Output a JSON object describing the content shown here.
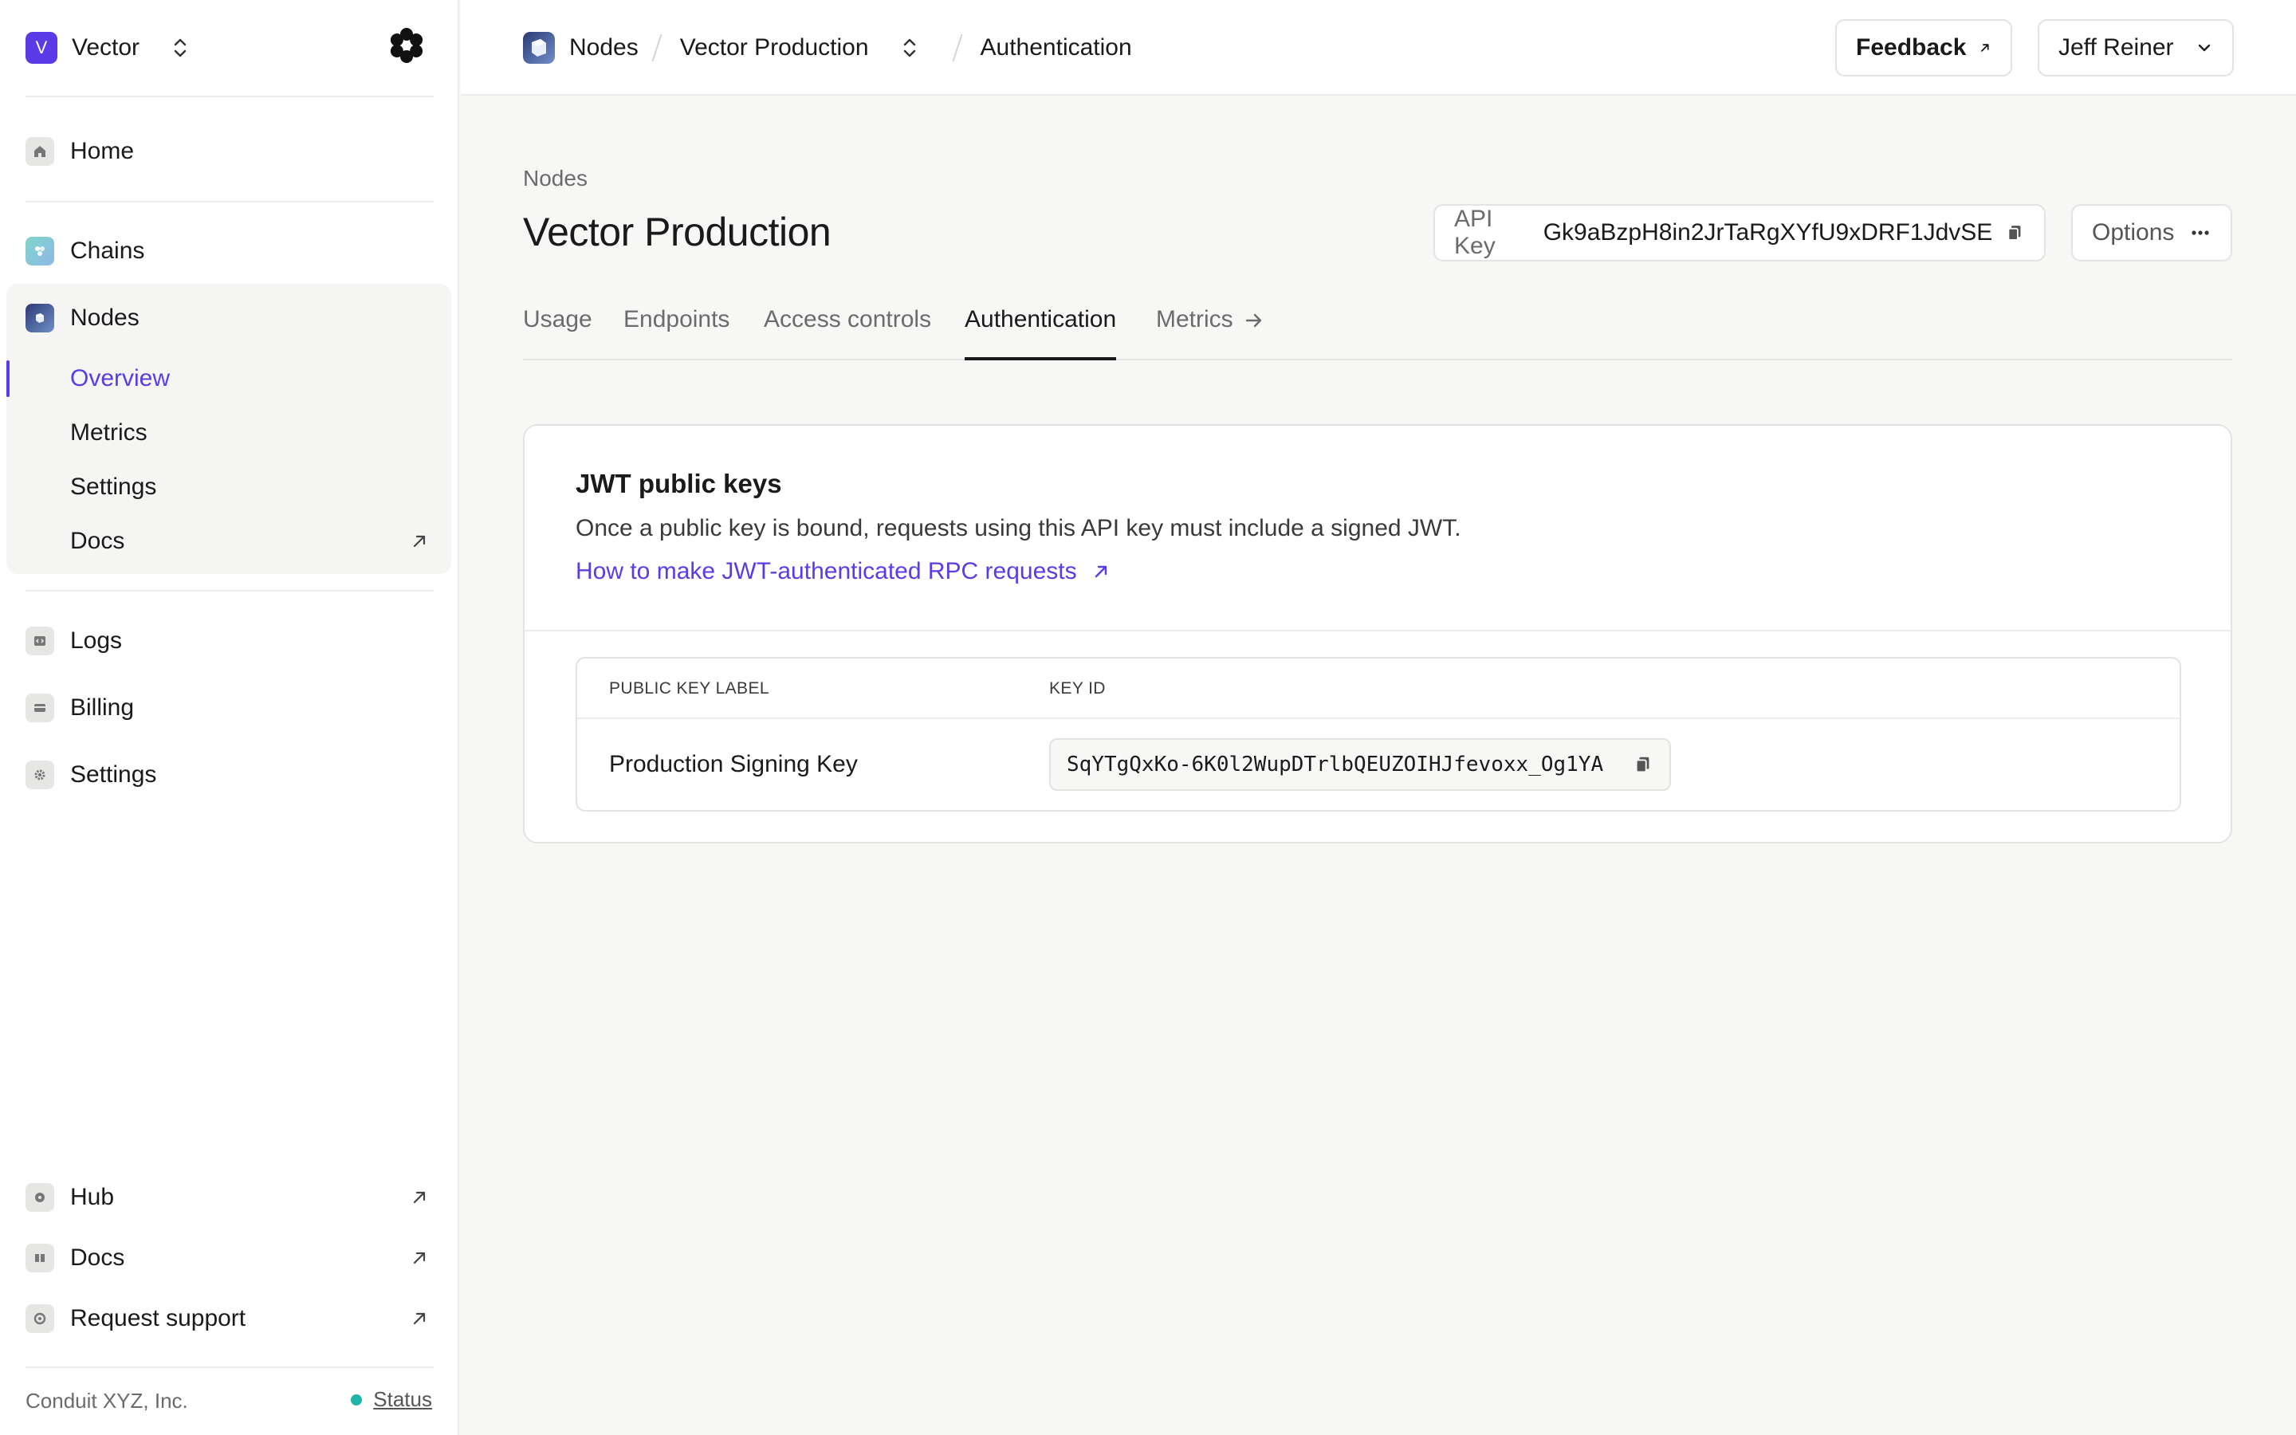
{
  "workspace": {
    "initial": "V",
    "name": "Vector"
  },
  "sidebar": {
    "home": "Home",
    "chains": "Chains",
    "nodes": "Nodes",
    "nodes_sub": [
      "Overview",
      "Metrics",
      "Settings",
      "Docs"
    ],
    "logs": "Logs",
    "billing": "Billing",
    "settings": "Settings",
    "hub": "Hub",
    "docs": "Docs",
    "support": "Request support",
    "company": "Conduit XYZ, Inc.",
    "status": "Status"
  },
  "breadcrumb": {
    "section": "Nodes",
    "project": "Vector Production",
    "page": "Authentication"
  },
  "top_actions": {
    "feedback": "Feedback",
    "user": "Jeff Reiner"
  },
  "header": {
    "subtitle": "Nodes",
    "title": "Vector Production",
    "api_key_label": "API Key",
    "api_key_value": "Gk9aBzpH8in2JrTaRgXYfU9xDRF1JdvSE",
    "options": "Options"
  },
  "tabs": [
    "Usage",
    "Endpoints",
    "Access controls",
    "Authentication",
    "Metrics"
  ],
  "active_tab": "Authentication",
  "card": {
    "title": "JWT public keys",
    "description": "Once a public key is bound, requests using this API key must include a signed JWT.",
    "link": "How to make JWT-authenticated RPC requests",
    "columns": [
      "PUBLIC KEY LABEL",
      "KEY ID"
    ],
    "rows": [
      {
        "label": "Production Signing Key",
        "key_id": "SqYTgQxKo-6K0l2WupDTrlbQEUZOIHJfevoxx_Og1YA"
      }
    ]
  },
  "colors": {
    "accent": "#5b3be8",
    "status_ok": "#1fb5a8"
  }
}
